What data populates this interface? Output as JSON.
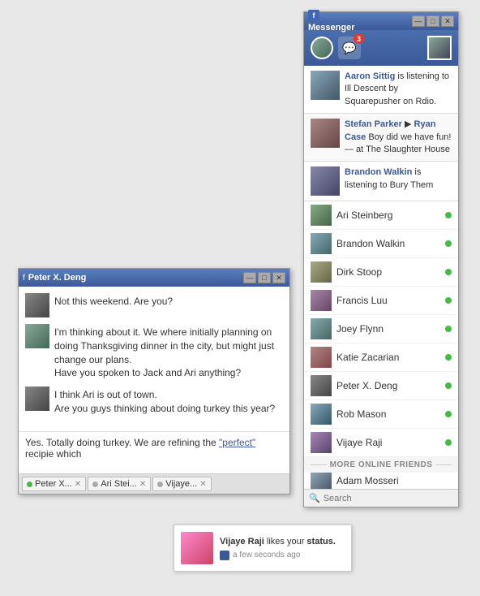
{
  "messenger": {
    "title": "Messenger",
    "controls": {
      "minimize": "—",
      "restore": "□",
      "close": "✕"
    },
    "notification_count": "3",
    "news_items": [
      {
        "id": "aaron",
        "user": "Aaron Sittig",
        "text": " is listening to Ill Descent by Squarepusher on Rdio.",
        "avatar_class": "av-aaron"
      },
      {
        "id": "stefan",
        "user": "Stefan Parker",
        "arrow": " ▶ ",
        "user2": "Ryan Case",
        "text": " Boy did we have fun! — at The Slaughter House",
        "avatar_class": "av-stefan"
      },
      {
        "id": "brandon-news",
        "user": "Brandon Walkin",
        "text": " is listening to Bury Them",
        "avatar_class": "av-brandon"
      }
    ],
    "friends": [
      {
        "name": "Ari Steinberg",
        "online": true,
        "avatar_class": "av-ari"
      },
      {
        "name": "Brandon Walkin",
        "online": true,
        "avatar_class": "av-brandonw"
      },
      {
        "name": "Dirk Stoop",
        "online": true,
        "avatar_class": "av-dirk"
      },
      {
        "name": "Francis Luu",
        "online": true,
        "avatar_class": "av-francis"
      },
      {
        "name": "Joey Flynn",
        "online": true,
        "avatar_class": "av-joey"
      },
      {
        "name": "Katie Zacarian",
        "online": true,
        "avatar_class": "av-katie"
      },
      {
        "name": "Peter X. Deng",
        "online": true,
        "avatar_class": "av-peter"
      },
      {
        "name": "Rob Mason",
        "online": true,
        "avatar_class": "av-rob"
      },
      {
        "name": "Vijaye Raji",
        "online": true,
        "avatar_class": "av-vijaye"
      }
    ],
    "more_divider": "MORE ONLINE FRIENDS",
    "partial_friend": "Adam Mosseri",
    "search_placeholder": "Search"
  },
  "chat": {
    "title": "Peter X. Deng",
    "controls": {
      "minimize": "—",
      "restore": "□",
      "close": "✕"
    },
    "messages": [
      {
        "id": "msg1",
        "text": "Not this weekend. Are you?",
        "avatar_class": "av-peter",
        "is_self": false
      },
      {
        "id": "msg2",
        "text": "I'm thinking about it. We where initially planning on doing Thanksgiving dinner in the city, but might just change our plans.\nHave you spoken to Jack and Ari anything?",
        "avatar_class": "av-user",
        "is_self": true
      },
      {
        "id": "msg3",
        "text": "I think Ari is out of town.\nAre you guys thinking about doing turkey this year?",
        "avatar_class": "av-peter",
        "is_self": false
      }
    ],
    "input_text_before": "Yes. Totally doing turkey. We are refining the ",
    "input_highlight": "\"perfect\"",
    "input_text_after": " recipie which",
    "tabs": [
      {
        "name": "Peter X...",
        "online": true
      },
      {
        "name": "Ari Stei...",
        "online": false
      },
      {
        "name": "Vijaye...",
        "online": false
      }
    ]
  },
  "notification": {
    "user": "Vijaye Raji",
    "action": " likes your ",
    "target": "status.",
    "time": "a few seconds ago",
    "avatar_class": "av-vijaye-notif"
  }
}
